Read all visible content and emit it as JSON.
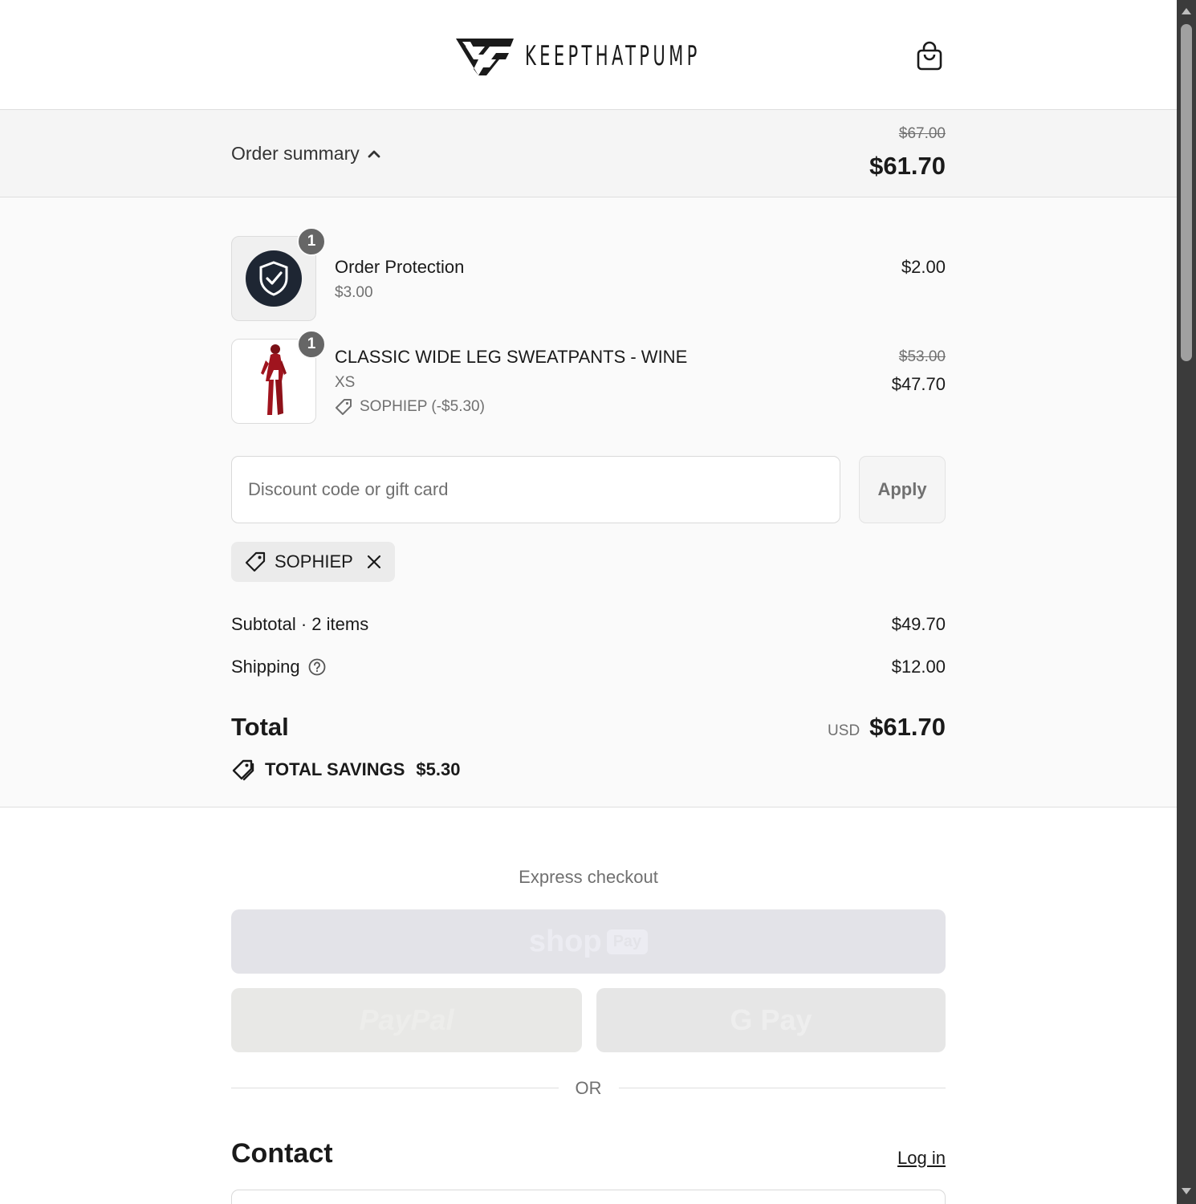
{
  "header": {
    "brand_name": "KEEPTHATPUMP",
    "cart_icon": "shopping-bag-icon"
  },
  "summary_bar": {
    "toggle_label": "Order summary",
    "original_total": "$67.00",
    "total": "$61.70"
  },
  "line_items": [
    {
      "quantity": "1",
      "name": "Order Protection",
      "subtitle": "$3.00",
      "price": "$2.00",
      "image_icon": "shield-check-icon"
    },
    {
      "quantity": "1",
      "name": "CLASSIC WIDE LEG SWEATPANTS - WINE",
      "subtitle": "XS",
      "discount": "SOPHIEP (-$5.30)",
      "original_price": "$53.00",
      "price": "$47.70",
      "image_icon": "product-photo"
    }
  ],
  "discount": {
    "placeholder": "Discount code or gift card",
    "value": "",
    "apply_label": "Apply",
    "applied_code": "SOPHIEP"
  },
  "totals": {
    "subtotal_label": "Subtotal · 2 items",
    "subtotal_value": "$49.70",
    "shipping_label": "Shipping",
    "shipping_value": "$12.00",
    "total_label": "Total",
    "currency": "USD",
    "total_value": "$61.70",
    "savings_label": "TOTAL SAVINGS",
    "savings_value": "$5.30"
  },
  "express": {
    "title": "Express checkout",
    "shop_label": "shop",
    "shop_badge": "Pay",
    "paypal_label": "PayPal",
    "gpay_label": "G Pay",
    "or_label": "OR"
  },
  "contact": {
    "title": "Contact",
    "login_label": "Log in"
  },
  "colors": {
    "text": "#1a1a1a",
    "muted": "#707070",
    "summary_bg": "#f5f5f5",
    "badge": "#666666",
    "shield_bg": "#1e2633",
    "product": "#a0141e"
  }
}
